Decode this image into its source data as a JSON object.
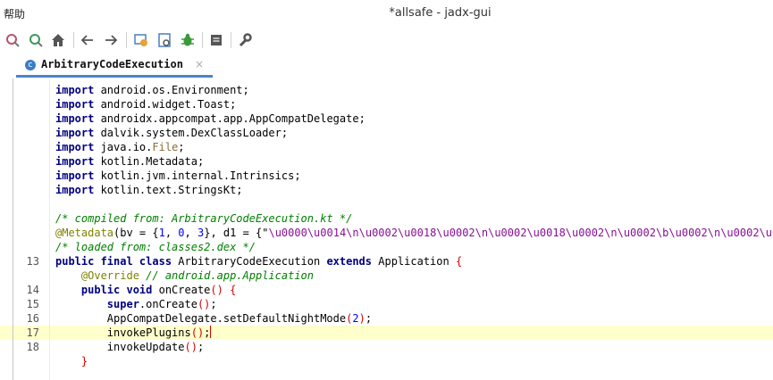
{
  "window": {
    "title": "*allsafe - jadx-gui",
    "menu_label": "帮助"
  },
  "toolbar": {
    "icons": [
      "search-text-icon",
      "search-class-icon",
      "home-icon",
      "back-icon",
      "forward-icon",
      "sync-icon",
      "decompile-icon",
      "debug-icon",
      "log-icon",
      "settings-icon"
    ],
    "colors": {
      "accent": "#4a86c7",
      "highlight_line": "#ffffcc"
    }
  },
  "tab": {
    "label": "ArbitraryCodeExecution",
    "close_glyph": "×"
  },
  "editor": {
    "lines": [
      {
        "num": "",
        "tokens": [
          {
            "t": "import",
            "c": "kw"
          },
          {
            "t": " android.os.Environment;",
            "c": ""
          }
        ]
      },
      {
        "num": "",
        "tokens": [
          {
            "t": "import",
            "c": "kw"
          },
          {
            "t": " android.widget.Toast;",
            "c": ""
          }
        ]
      },
      {
        "num": "",
        "tokens": [
          {
            "t": "import",
            "c": "kw"
          },
          {
            "t": " androidx.appcompat.app.AppCompatDelegate;",
            "c": ""
          }
        ]
      },
      {
        "num": "",
        "tokens": [
          {
            "t": "import",
            "c": "kw"
          },
          {
            "t": " dalvik.system.DexClassLoader;",
            "c": ""
          }
        ]
      },
      {
        "num": "",
        "tokens": [
          {
            "t": "import",
            "c": "kw"
          },
          {
            "t": " java.io.",
            "c": ""
          },
          {
            "t": "File",
            "c": "fi"
          },
          {
            "t": ";",
            "c": ""
          }
        ]
      },
      {
        "num": "",
        "tokens": [
          {
            "t": "import",
            "c": "kw"
          },
          {
            "t": " kotlin.Metadata;",
            "c": ""
          }
        ]
      },
      {
        "num": "",
        "tokens": [
          {
            "t": "import",
            "c": "kw"
          },
          {
            "t": " kotlin.jvm.internal.Intrinsics;",
            "c": ""
          }
        ]
      },
      {
        "num": "",
        "tokens": [
          {
            "t": "import",
            "c": "kw"
          },
          {
            "t": " kotlin.text.StringsKt;",
            "c": ""
          }
        ]
      },
      {
        "num": "",
        "tokens": []
      },
      {
        "num": "",
        "tokens": [
          {
            "t": "/* compiled from: ArbitraryCodeExecution.kt */",
            "c": "cm"
          }
        ]
      },
      {
        "num": "",
        "tokens": [
          {
            "t": "@Metadata",
            "c": "an"
          },
          {
            "t": "(bv = {",
            "c": ""
          },
          {
            "t": "1",
            "c": "num"
          },
          {
            "t": ", ",
            "c": ""
          },
          {
            "t": "0",
            "c": "num"
          },
          {
            "t": ", ",
            "c": ""
          },
          {
            "t": "3",
            "c": "num"
          },
          {
            "t": "}, d1 = {\"",
            "c": ""
          },
          {
            "t": "\\u0000\\u0014\\n\\u0002\\u0018\\u0002\\n\\u0002\\u0018\\u0002\\n\\u0002\\b\\u0002\\n\\u0002\\u0",
            "c": "mc"
          }
        ]
      },
      {
        "num": "",
        "tokens": [
          {
            "t": "/* loaded from: classes2.dex */",
            "c": "cm"
          }
        ]
      },
      {
        "num": "13",
        "tokens": [
          {
            "t": "public final class",
            "c": "kw"
          },
          {
            "t": " ArbitraryCodeExecution ",
            "c": ""
          },
          {
            "t": "extends",
            "c": "kw"
          },
          {
            "t": " Application ",
            "c": ""
          },
          {
            "t": "{",
            "c": "p"
          }
        ]
      },
      {
        "num": "",
        "tokens": [
          {
            "t": "    @Override",
            "c": "an"
          },
          {
            "t": " // android.app.Application",
            "c": "cm"
          }
        ]
      },
      {
        "num": "14",
        "tokens": [
          {
            "t": "    public void",
            "c": "kw"
          },
          {
            "t": " onCreate",
            "c": ""
          },
          {
            "t": "()",
            "c": "p"
          },
          {
            "t": " ",
            "c": ""
          },
          {
            "t": "{",
            "c": "p"
          }
        ]
      },
      {
        "num": "15",
        "tokens": [
          {
            "t": "        super",
            "c": "kw"
          },
          {
            "t": ".onCreate",
            "c": ""
          },
          {
            "t": "()",
            "c": "p"
          },
          {
            "t": ";",
            "c": ""
          }
        ]
      },
      {
        "num": "16",
        "tokens": [
          {
            "t": "        AppCompatDelegate.setDefaultNightMode",
            "c": ""
          },
          {
            "t": "(",
            "c": "p"
          },
          {
            "t": "2",
            "c": "num"
          },
          {
            "t": ")",
            "c": "p"
          },
          {
            "t": ";",
            "c": ""
          }
        ]
      },
      {
        "num": "17",
        "highlight": true,
        "caret": true,
        "tokens": [
          {
            "t": "        invokePlugins",
            "c": ""
          },
          {
            "t": "()",
            "c": "p"
          },
          {
            "t": ";",
            "c": ""
          }
        ]
      },
      {
        "num": "18",
        "tokens": [
          {
            "t": "        invokeUpdate",
            "c": ""
          },
          {
            "t": "()",
            "c": "p"
          },
          {
            "t": ";",
            "c": ""
          }
        ]
      },
      {
        "num": "",
        "tokens": [
          {
            "t": "    }",
            "c": "p"
          }
        ]
      }
    ]
  }
}
